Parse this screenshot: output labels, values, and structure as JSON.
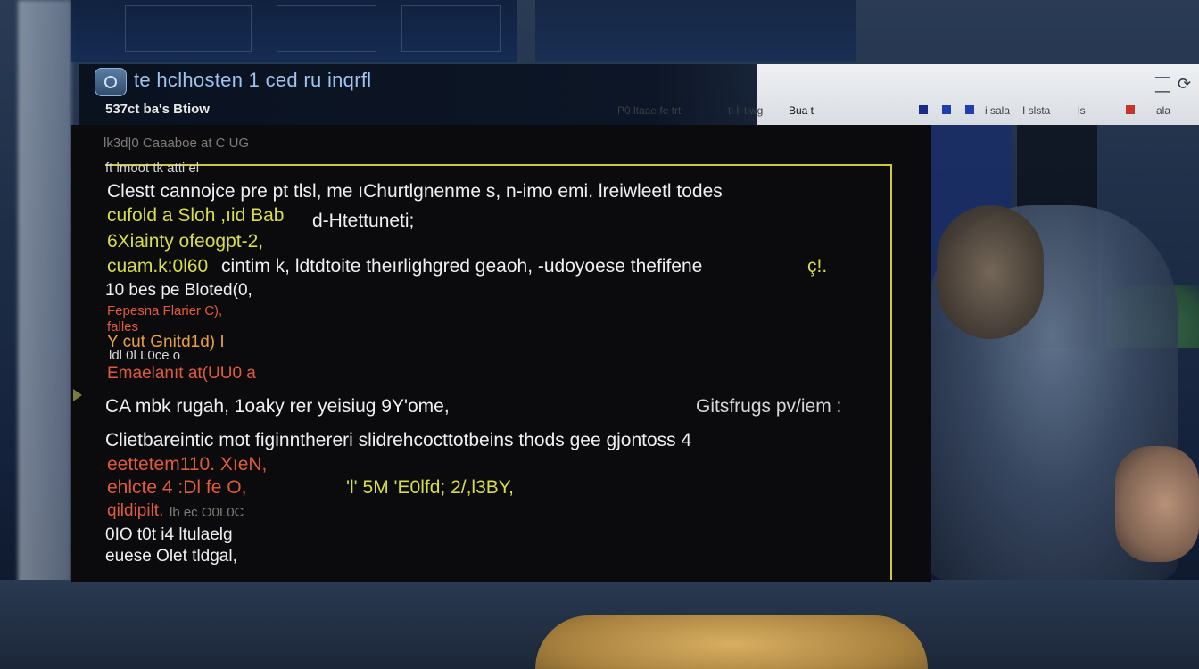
{
  "window": {
    "title": "te hclhosten 1 ced ru inqrfl",
    "subtitle": "537ct ba's Btiow",
    "toolbar_left": [
      "P0 ltaae fe trt",
      "ti ll tiwg"
    ],
    "toolbar_left_tail": "Bua t",
    "toolbar_right": [
      "i sala",
      "I slsta",
      "ls",
      "ala"
    ],
    "controls": [
      "—",
      "—",
      "⟳"
    ]
  },
  "terminal": {
    "header_lines": [
      {
        "text": "lk3d|0 Caaaboe at C UG",
        "color": "gray"
      },
      {
        "text": "ft lmoot tk atti el",
        "color": "dimwhite"
      }
    ],
    "lines": [
      {
        "text": "Clestt cannojce pre pt tlsl, me ıChurtlgnenme s, n-imo emi. lreiwleetl todes",
        "color": "white"
      },
      {
        "text": "cufold a Sloh ,ıid Bab ",
        "color": "yellow"
      },
      {
        "text": "d-Htettuneti;",
        "color": "white"
      },
      {
        "text": "6Xiainty ofeogpt-2,",
        "color": "yellow"
      },
      {
        "text": "cuam.k:0l60 ",
        "color": "yellow"
      },
      {
        "text": "cintim k, ldtdtoite  theırlighgred geaoh, -udoyoese thefifene ",
        "color": "white"
      },
      {
        "text": "ç!.",
        "color": "yellow"
      },
      {
        "text": "10 bes pe Bloted(0,",
        "color": "white"
      },
      {
        "text": "Fepesna Flarier C),",
        "color": "red"
      },
      {
        "text": "falles",
        "color": "red"
      },
      {
        "text": "Y cut Gnitd1d) I",
        "color": "orange"
      },
      {
        "text": "ldl 0l L0ce o",
        "color": "dimwhite"
      },
      {
        "text": "Emaelanıt at(UU0 a",
        "color": "red"
      },
      {
        "text": "CA mbk rugah, 1oaky rer yeisiug 9Y'ome,",
        "color": "white"
      },
      {
        "text": "Gitsfrugs pv/iem :",
        "color": "dimwhite"
      },
      {
        "text": "Clietbareintic mot figinnthereri slidrehcocttotbeins thods gee gjontoss 4",
        "color": "white"
      },
      {
        "text": "eettetem110. XıeN,",
        "color": "red"
      },
      {
        "text": "ehlcte 4 :Dl fe O,",
        "color": "red"
      },
      {
        "text": "'l' 5M 'E0lfd; 2/,l3BY,",
        "color": "yellow"
      },
      {
        "text": "qildipilt.",
        "color": "red"
      },
      {
        "text": " lb ec O0L0C",
        "color": "gray"
      },
      {
        "text": "0IO t0t i4 ltulaelg",
        "color": "white"
      },
      {
        "text": "euese Olet tldgal,",
        "color": "white"
      }
    ]
  },
  "colors": {
    "frame": "#cfc83a",
    "yellow": "#d8dd4a",
    "red": "#e05b3c",
    "white": "#f0f0f0"
  }
}
